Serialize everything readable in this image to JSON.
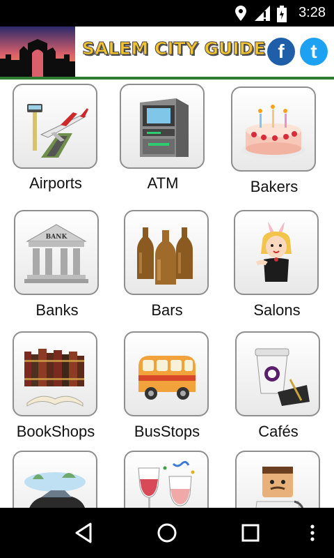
{
  "status_bar": {
    "time": "3:28",
    "icons": [
      "location-icon",
      "signal-icon",
      "battery-icon"
    ]
  },
  "header": {
    "title": "SALEM CITY GUIDE",
    "social": {
      "facebook_letter": "f",
      "twitter_letter": "t"
    },
    "colors": {
      "title": "#f4c430",
      "facebook": "#1f5ea8",
      "twitter": "#1da1f2",
      "divider": "#2e7d32"
    }
  },
  "categories": [
    {
      "label": "Airports",
      "icon": "airport-icon"
    },
    {
      "label": "ATM",
      "icon": "atm-icon"
    },
    {
      "label": "Bakers",
      "icon": "cake-icon"
    },
    {
      "label": "Banks",
      "icon": "bank-icon"
    },
    {
      "label": "Bars",
      "icon": "beer-bottles-icon"
    },
    {
      "label": "Salons",
      "icon": "salon-icon"
    },
    {
      "label": "BookShops",
      "icon": "books-icon"
    },
    {
      "label": "BusStops",
      "icon": "bus-icon"
    },
    {
      "label": "Cafés",
      "icon": "coffee-icon"
    },
    {
      "label": "",
      "icon": "car-icon"
    },
    {
      "label": "",
      "icon": "wine-glasses-icon"
    },
    {
      "label": "",
      "icon": "doctor-icon"
    }
  ],
  "nav_bar": {
    "icons": [
      "back-icon",
      "home-icon",
      "recents-icon",
      "menu-icon"
    ]
  }
}
